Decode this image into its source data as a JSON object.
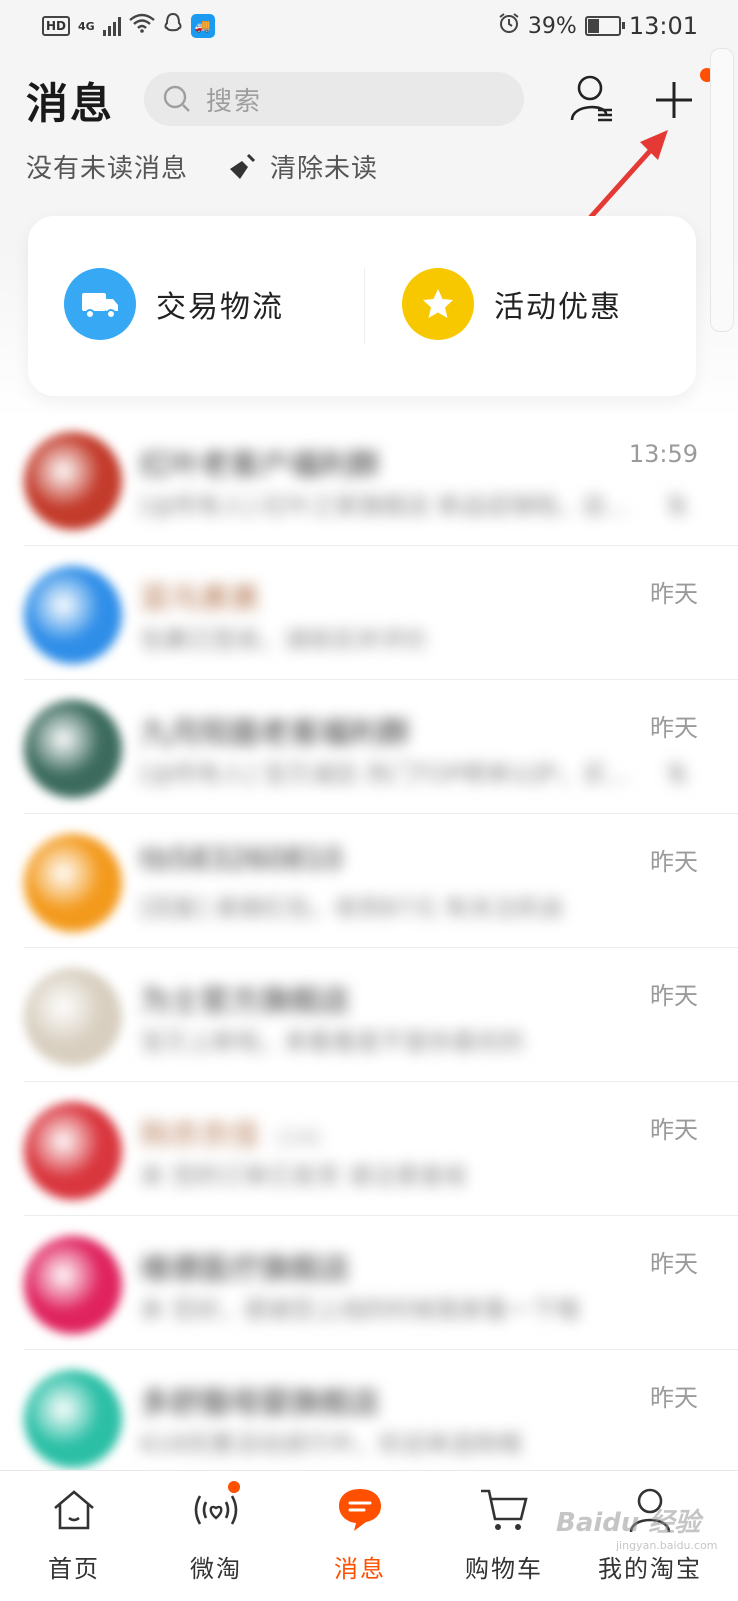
{
  "status_bar": {
    "hd": "HD",
    "network": "4G",
    "battery": "39%",
    "battery_level": 0.39,
    "time": "13:01"
  },
  "header": {
    "title": "消息",
    "search_placeholder": "搜索",
    "status_text": "没有未读消息",
    "clear_label": "清除未读"
  },
  "quick_actions": [
    {
      "label": "交易物流",
      "icon": "truck-icon",
      "color": "#36a8f4"
    },
    {
      "label": "活动优惠",
      "icon": "star-icon",
      "color": "#f7c800"
    }
  ],
  "conversations": [
    {
      "name": "红叶老客户福利群",
      "preview": "[@所有人] 红叶之家旗舰店 新品促销啦，店...",
      "time": "13:59",
      "muted": true,
      "avatar_color": "#c33b2b",
      "accent": false,
      "tag": ""
    },
    {
      "name": "菜鸟裹裹",
      "preview": "包裹已签收，请核实并评价",
      "time": "昨天",
      "muted": false,
      "avatar_color": "#2f8ee8",
      "accent": true,
      "tag": ""
    },
    {
      "name": "九月阳面老客福利群",
      "preview": "[@所有人] 宝贝减后 热门TOP榜单以护，买...",
      "time": "昨天",
      "muted": true,
      "avatar_color": "#3c6b5e",
      "accent": false,
      "tag": ""
    },
    {
      "name": "tb583260810",
      "preview": "[回复] 谢谢红包，收到87元 有关注机会",
      "time": "昨天",
      "muted": false,
      "avatar_color": "#f39a1d",
      "accent": false,
      "tag": ""
    },
    {
      "name": "为士官方旗舰店",
      "preview": "宝贝上新啦，来看看是不是你喜欢的",
      "time": "昨天",
      "muted": false,
      "avatar_color": "#d8cfc0",
      "accent": false,
      "tag": ""
    },
    {
      "name": "购衣衣佳",
      "preview": "亲 您的订单已发货 请注意查收",
      "time": "昨天",
      "muted": false,
      "avatar_color": "#d9363e",
      "accent": true,
      "tag": "(14)"
    },
    {
      "name": "维德医疗旗舰店",
      "preview": "亲 您好，感谢您上线的时候我家看一下哦",
      "time": "昨天",
      "muted": false,
      "avatar_color": "#e0235f",
      "accent": false,
      "tag": ""
    },
    {
      "name": "多舒服母婴旗舰店",
      "preview": "618优惠活动进行中，欢迎来选购哦",
      "time": "昨天",
      "muted": false,
      "avatar_color": "#2bbfa6",
      "accent": false,
      "tag": ""
    }
  ],
  "tabs": [
    {
      "label": "首页",
      "icon": "home-icon",
      "active": false
    },
    {
      "label": "微淘",
      "icon": "weitao-icon",
      "active": false
    },
    {
      "label": "消息",
      "icon": "message-icon",
      "active": true
    },
    {
      "label": "购物车",
      "icon": "cart-icon",
      "active": false
    },
    {
      "label": "我的淘宝",
      "icon": "profile-icon",
      "active": false
    }
  ],
  "watermark": {
    "brand": "Baidu 经验",
    "url": "jingyan.baidu.com"
  },
  "colors": {
    "accent": "#ff5000",
    "annotation_arrow": "#e53935"
  }
}
